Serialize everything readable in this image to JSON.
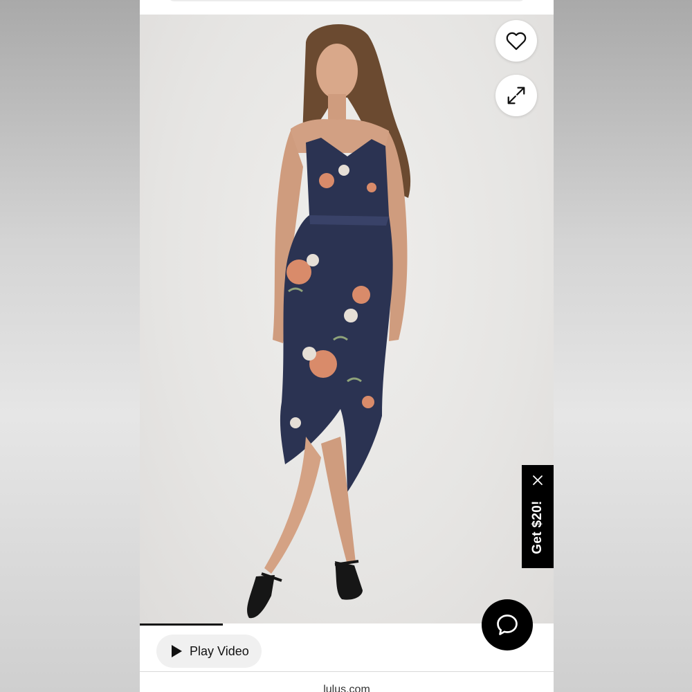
{
  "product": {
    "image_alt": "Model wearing navy floral satin high-low midi dress",
    "progress_fraction": 0.2
  },
  "actions": {
    "favorite_icon": "heart-icon",
    "expand_icon": "expand-icon",
    "chat_icon": "chat-bubble-icon"
  },
  "promo": {
    "label": "Get $20!",
    "close_icon": "close-icon"
  },
  "video": {
    "play_label": "Play Video",
    "play_icon": "play-icon"
  },
  "browser": {
    "url": "lulus.com"
  },
  "colors": {
    "dress_navy": "#2b3352",
    "accent_black": "#000000",
    "flower_peach": "#d98b6a"
  }
}
